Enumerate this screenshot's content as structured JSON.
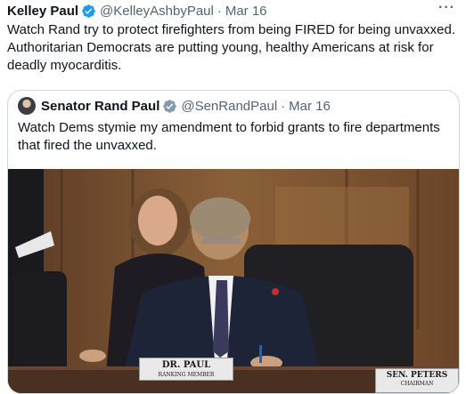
{
  "tweet": {
    "author_name": "Kelley Paul",
    "handle": "@KelleyAshbyPaul",
    "separator": "·",
    "date": "Mar 16",
    "more_label": "···",
    "text": "Watch Rand try to protect firefighters from being FIRED for being unvaxxed. Authoritarian Democrats are putting young, healthy Americans at risk for deadly myocarditis."
  },
  "quoted": {
    "author_name": "Senator Rand Paul",
    "handle": "@SenRandPaul",
    "separator": "·",
    "date": "Mar 16",
    "text": "Watch Dems stymie my amendment to forbid grants to fire departments that fired the unvaxxed.",
    "media": {
      "placard_main_name": "DR. PAUL",
      "placard_main_title": "RANKING MEMBER",
      "placard_right_name": "SEN. PETERS",
      "placard_right_title": "CHAIRMAN"
    }
  },
  "colors": {
    "verified": "#1d9bf0",
    "verified_government": "#829aab",
    "secondary_text": "#536471",
    "border": "#cfd9de"
  },
  "icons": {
    "verified": "verified-badge-icon",
    "verified_government": "gray-verified-badge-icon",
    "more": "more-options-icon"
  }
}
